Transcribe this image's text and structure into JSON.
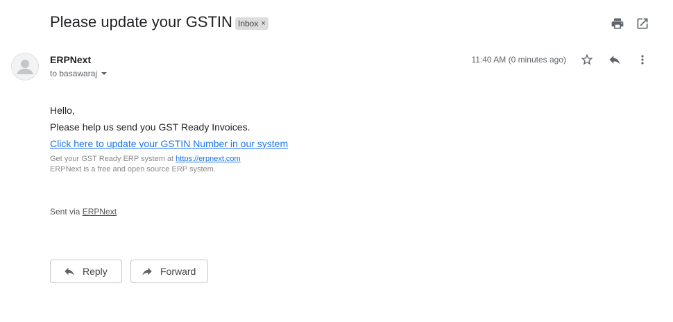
{
  "header": {
    "subject": "Please update your GSTIN",
    "label": "Inbox",
    "label_close": "×",
    "icons": [
      "print-icon",
      "open-in-new-window-icon"
    ]
  },
  "message": {
    "sender": "ERPNext",
    "recipient": "to basawaraj",
    "time": "11:40 AM (0 minutes ago)",
    "actions": [
      "star-icon",
      "reply-icon",
      "more-vert-icon"
    ],
    "body": {
      "greeting": "Hello,",
      "line1": "Please help us send you GST Ready Invoices.",
      "link_text": "Click here to update your GSTIN Number in our system",
      "footer_prefix": "Get your GST Ready ERP system at ",
      "footer_link": "https://erpnext.com",
      "footer_line2": "ERPNext is a free and open source ERP system.",
      "sent_prefix": "Sent via ",
      "sent_link": "ERPNext"
    }
  },
  "buttons": {
    "reply": "Reply",
    "forward": "Forward"
  },
  "colors": {
    "link": "#1a73e8",
    "label_bg": "#dddddd",
    "icon": "#5f6368"
  }
}
